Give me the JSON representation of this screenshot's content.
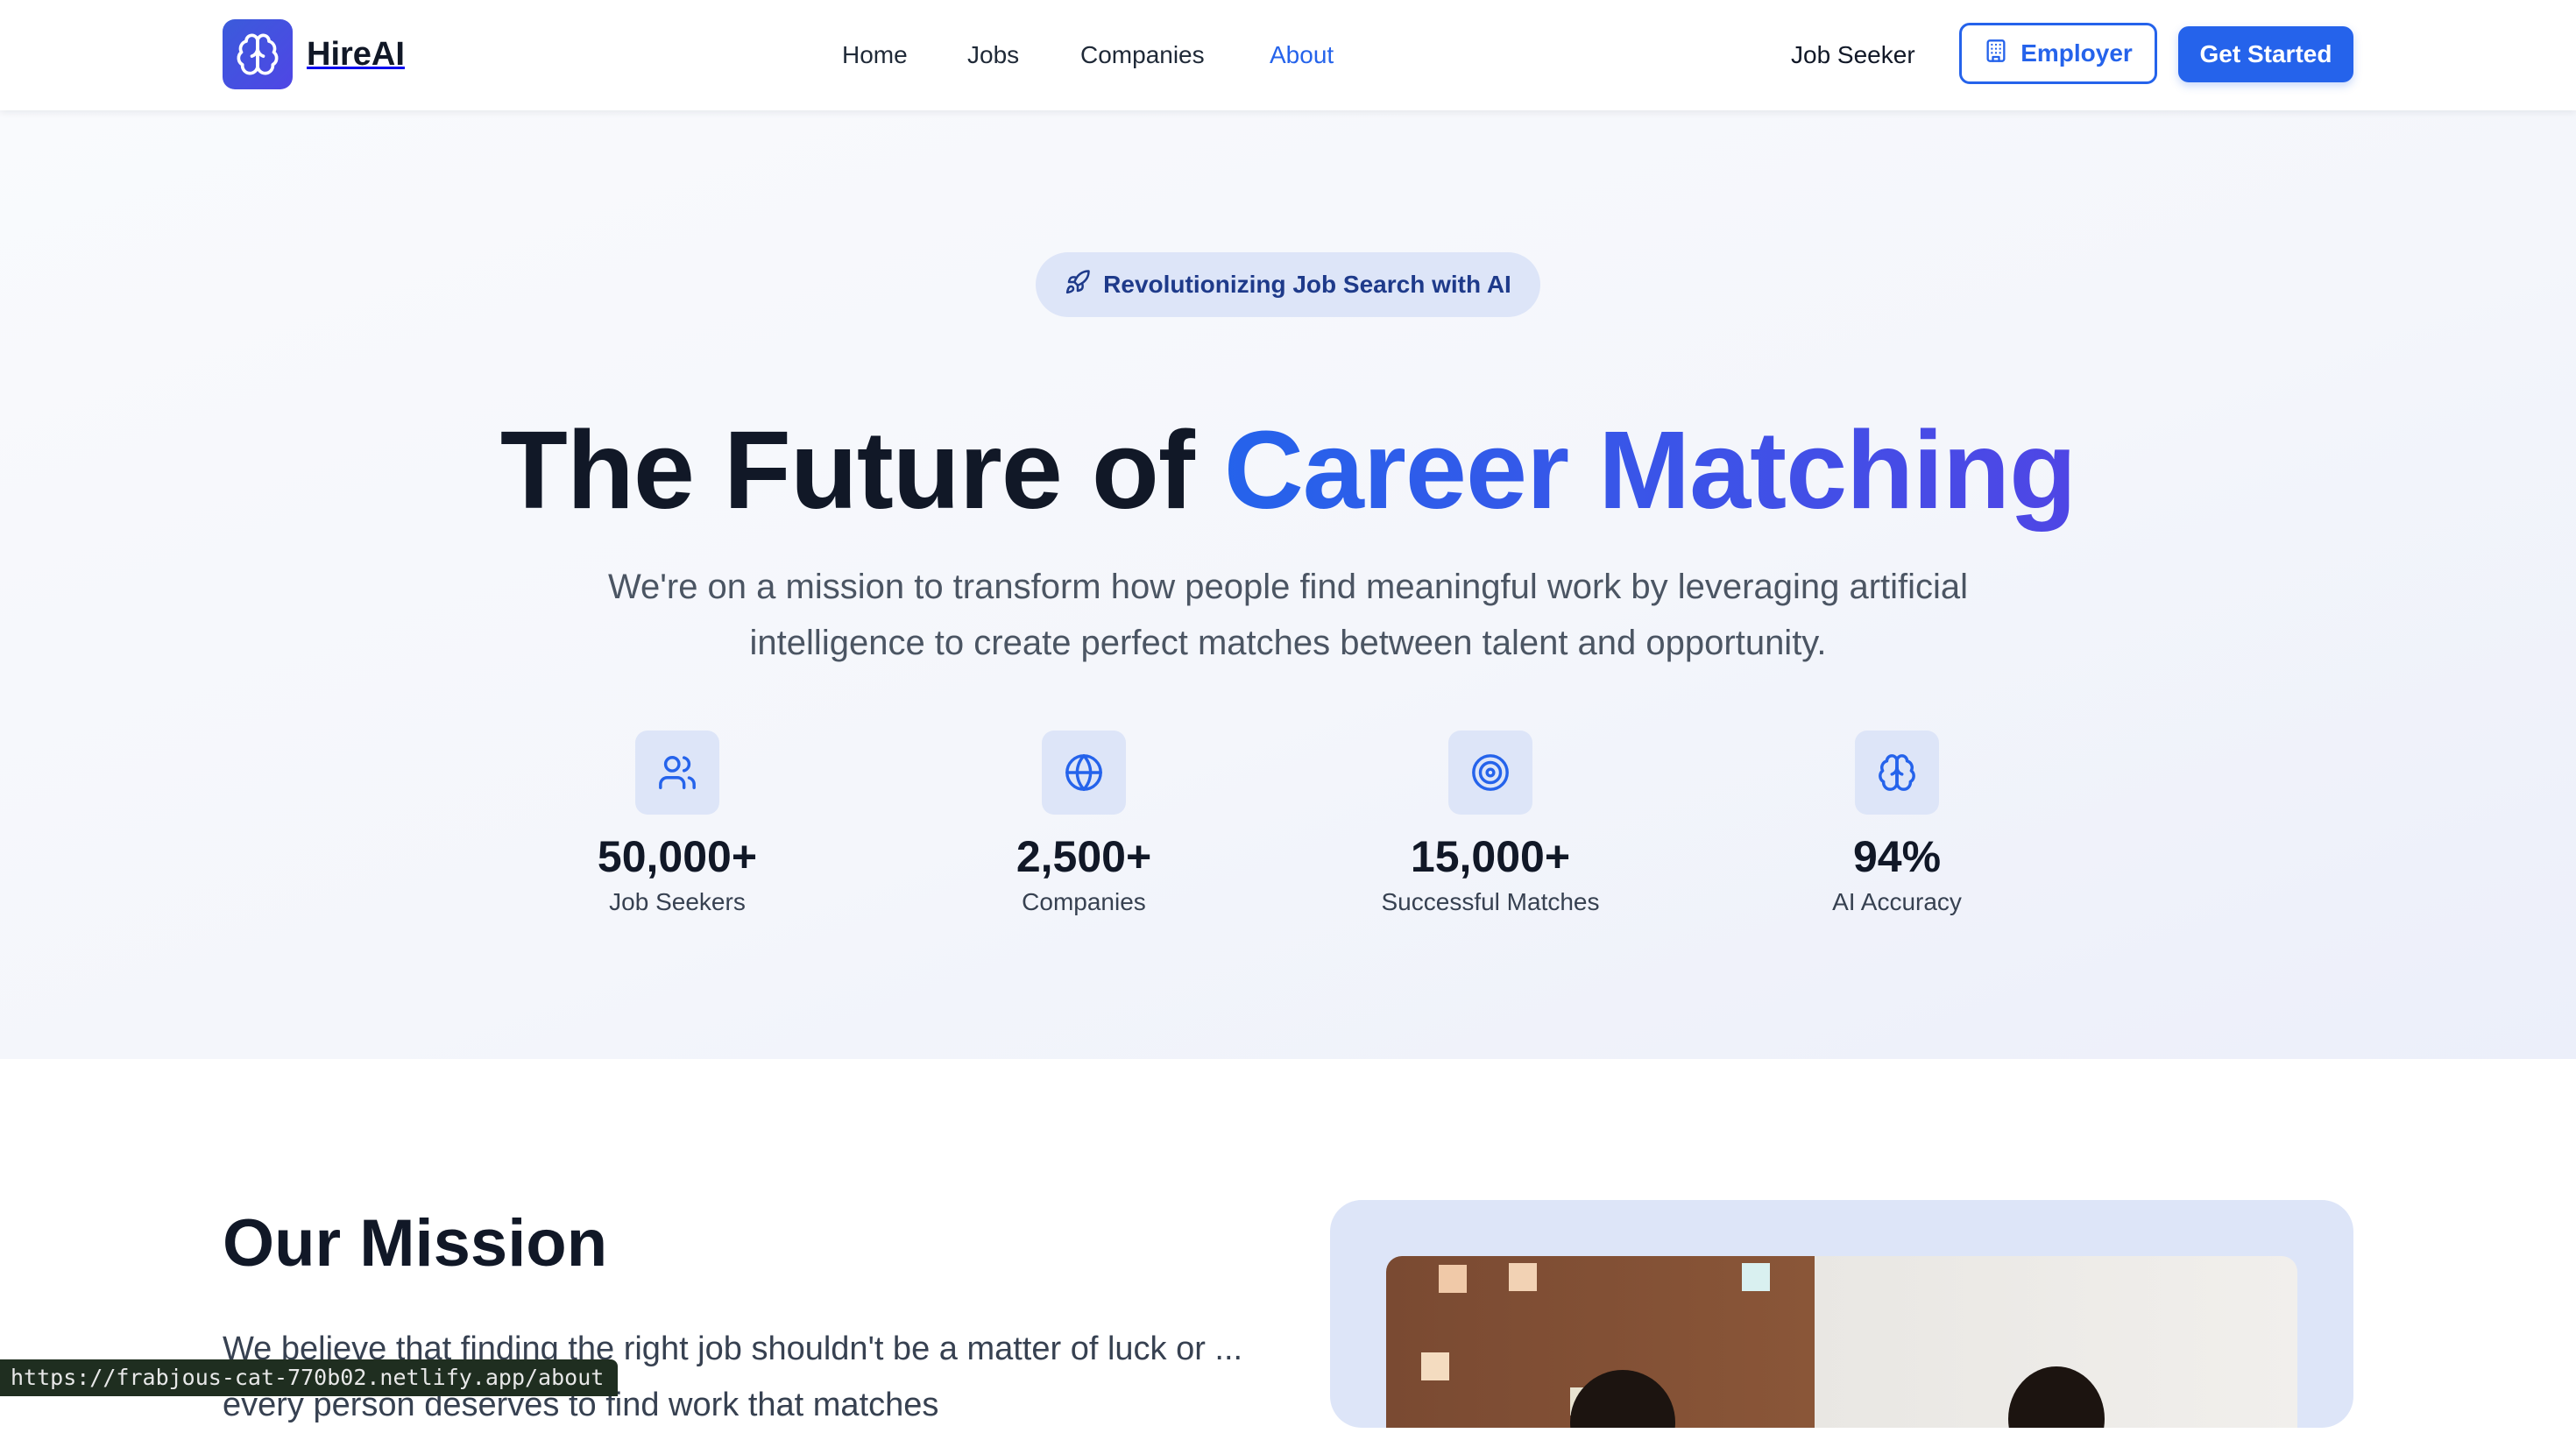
{
  "brand": {
    "name": "HireAI",
    "logo_icon": "brain-icon"
  },
  "nav": {
    "items": [
      {
        "label": "Home",
        "active": false
      },
      {
        "label": "Jobs",
        "active": false
      },
      {
        "label": "Companies",
        "active": false
      },
      {
        "label": "About",
        "active": true
      }
    ]
  },
  "header_actions": {
    "job_seeker": "Job Seeker",
    "employer": "Employer",
    "employer_icon": "building-icon",
    "get_started": "Get Started"
  },
  "hero": {
    "badge": "Revolutionizing Job Search with AI",
    "badge_icon": "rocket-icon",
    "title_plain": "The Future of ",
    "title_highlight": "Career Matching",
    "subtitle": "We're on a mission to transform how people find meaningful work by leveraging artificial intelligence to create perfect matches between talent and opportunity."
  },
  "stats": [
    {
      "value": "50,000+",
      "label": "Job Seekers",
      "icon": "users-icon"
    },
    {
      "value": "2,500+",
      "label": "Companies",
      "icon": "globe-icon"
    },
    {
      "value": "15,000+",
      "label": "Successful Matches",
      "icon": "target-icon"
    },
    {
      "value": "94%",
      "label": "AI Accuracy",
      "icon": "brain-icon"
    }
  ],
  "mission": {
    "title": "Our Mission",
    "text": "We believe that finding the right job shouldn't be a matter of luck or ... every person deserves to find work that matches"
  },
  "status_bar": {
    "url": "https://frabjous-cat-770b02.netlify.app/about"
  },
  "colors": {
    "accent": "#2563eb",
    "accent_indigo": "#4f46e5",
    "badge_bg": "#dde5f8",
    "heading": "#111827"
  }
}
